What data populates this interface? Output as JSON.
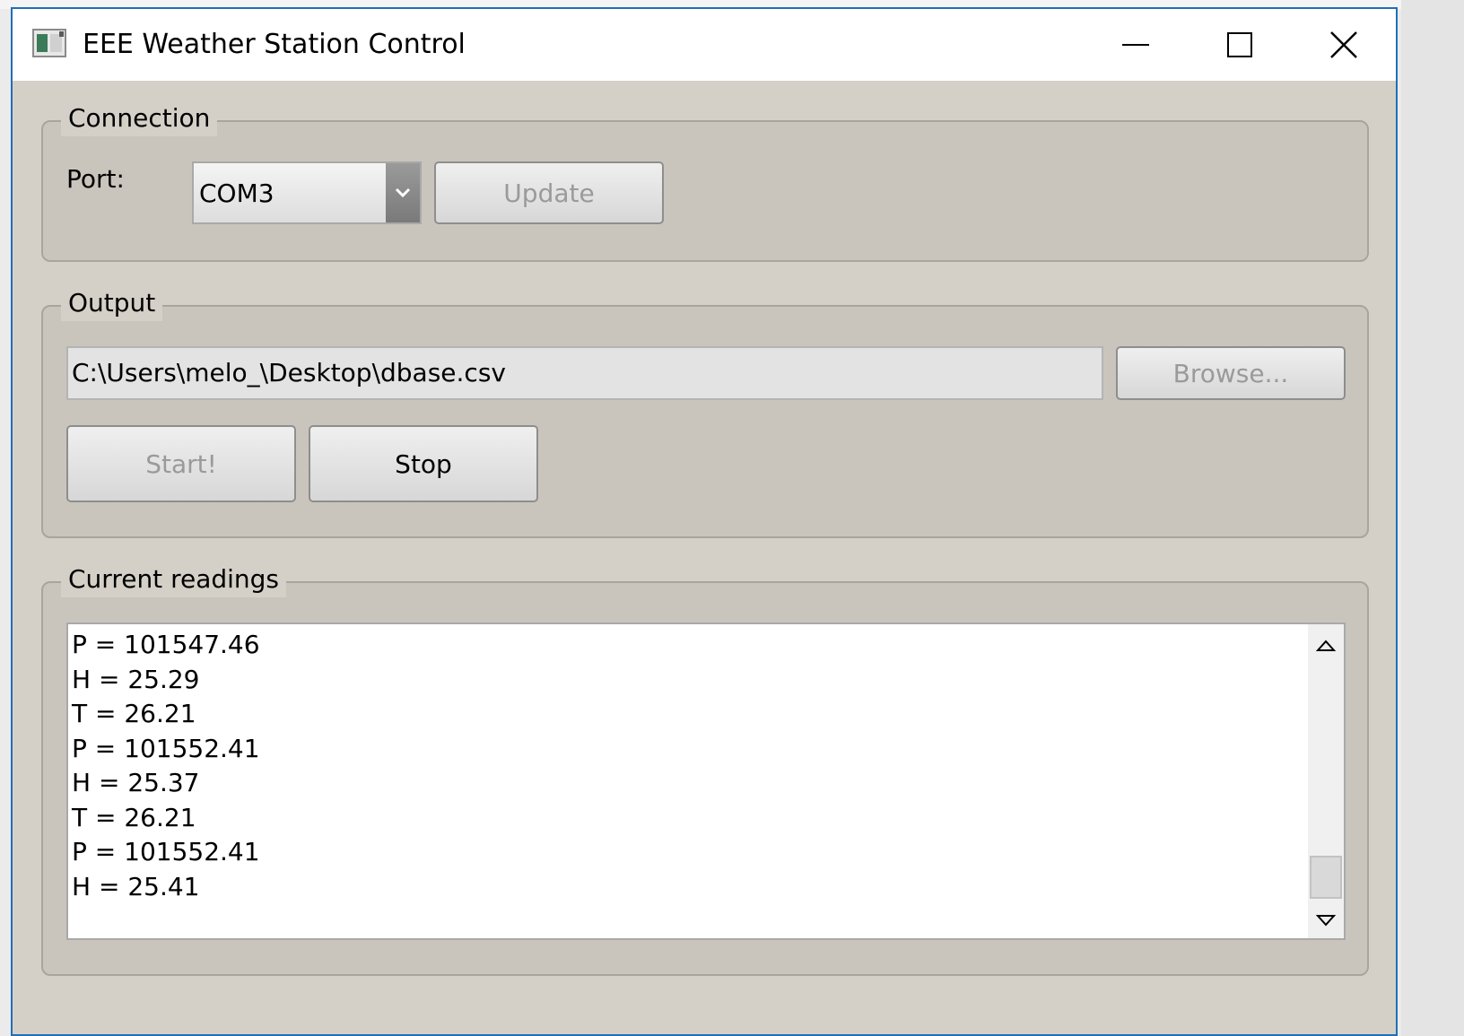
{
  "window": {
    "title": "EEE Weather Station Control"
  },
  "connection": {
    "group_label": "Connection",
    "port_label": "Port:",
    "port_value": "COM3",
    "update_label": "Update"
  },
  "output": {
    "group_label": "Output",
    "path_value": "C:\\Users\\melo_\\Desktop\\dbase.csv",
    "browse_label": "Browse...",
    "start_label": "Start!",
    "stop_label": "Stop"
  },
  "readings": {
    "group_label": "Current readings",
    "lines": [
      "P = 101547.46",
      "H = 25.29",
      "T = 26.21",
      "P = 101552.41",
      "H = 25.37",
      "T = 26.21",
      "P = 101552.41",
      "H = 25.41"
    ]
  },
  "icons": {
    "app": "app-window-icon",
    "minimize": "minimize-icon",
    "maximize": "maximize-icon",
    "close": "close-icon",
    "dropdown": "chevron-down-icon",
    "scroll_up": "triangle-up-icon",
    "scroll_down": "triangle-down-icon"
  },
  "colors": {
    "window_bg": "#d4d0c8",
    "titlebar_bg": "#ffffff",
    "window_border": "#1f6fb8",
    "disabled_text": "#9a9a9a"
  }
}
